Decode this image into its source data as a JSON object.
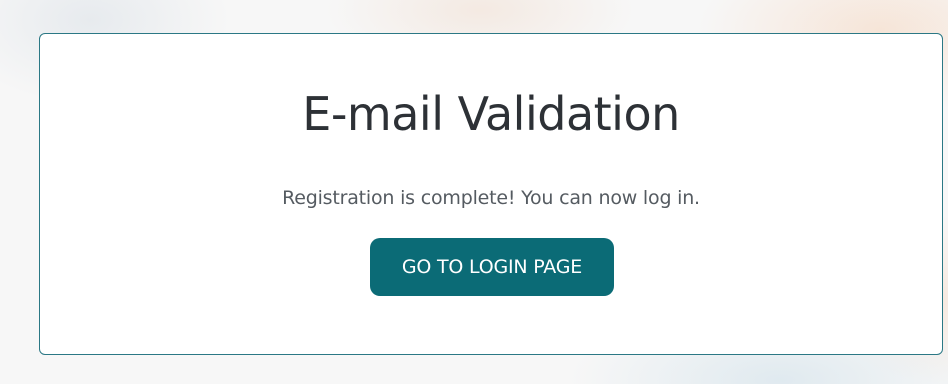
{
  "card": {
    "title": "E-mail Validation",
    "message": "Registration is complete! You can now log in.",
    "button_label": "GO TO LOGIN PAGE"
  },
  "colors": {
    "accent": "#0b6b76",
    "card_border": "#2b7885",
    "title_text": "#2d3136",
    "body_text": "#555b61"
  }
}
